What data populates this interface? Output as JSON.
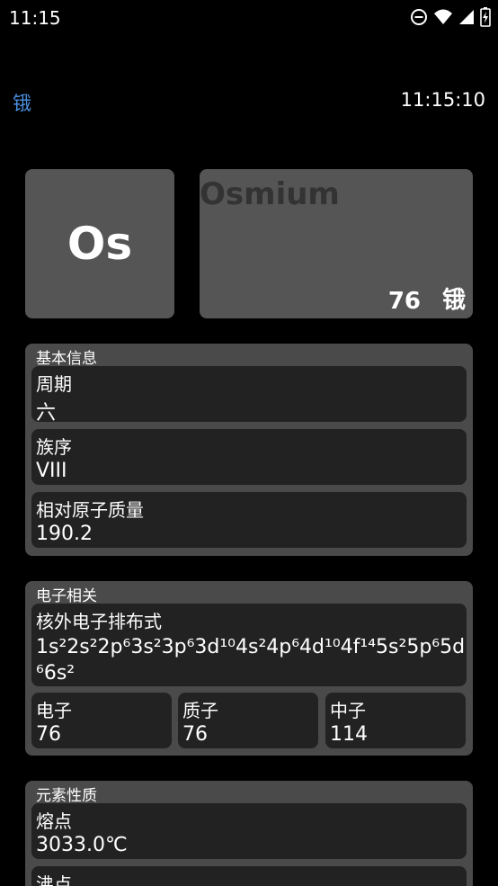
{
  "status_bar": {
    "time": "11:15",
    "icons": [
      "do-not-disturb-icon",
      "wifi-icon",
      "signal-icon",
      "battery-icon"
    ]
  },
  "header": {
    "title": "锇",
    "clock": "11:15:10"
  },
  "element": {
    "symbol": "Os",
    "name_en": "Osmium",
    "atomic_number": "76",
    "name_cn": "锇"
  },
  "basic_info": {
    "title": "基本信息",
    "period_label": "周期",
    "period_value": "六",
    "group_label": "族序",
    "group_value": "VIII",
    "mass_label": "相对原子质量",
    "mass_value": "190.2"
  },
  "electron_info": {
    "title": "电子相关",
    "config_label": "核外电子排布式",
    "config_value": "1s²2s²2p⁶3s²3p⁶3d¹⁰4s²4p⁶4d¹⁰4f¹⁴5s²5p⁶5d⁶6s²",
    "electron_label": "电子",
    "electron_value": "76",
    "proton_label": "质子",
    "proton_value": "76",
    "neutron_label": "中子",
    "neutron_value": "114"
  },
  "properties": {
    "title": "元素性质",
    "melting_label": "熔点",
    "melting_value": "3033.0℃",
    "boiling_label": "沸点"
  }
}
